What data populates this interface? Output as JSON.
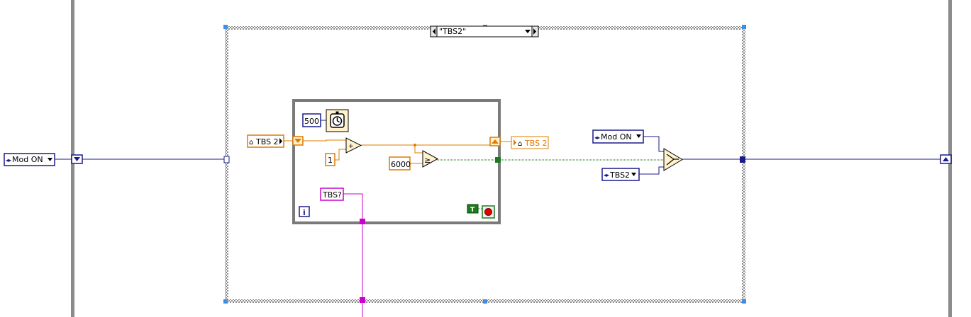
{
  "colors": {
    "enum_blue": "#1a1a8c",
    "numeric_orange": "#e07b00",
    "string_pink": "#cc00cc",
    "boolean_green": "#006600",
    "loop_frame": "#7a7a7a",
    "selection_blue": "#3c8ee6"
  },
  "outer": {
    "left_enum_label": "Mod ON"
  },
  "case_structure": {
    "selector_label": "\"TBS2\""
  },
  "while_loop": {
    "wait_constant": "500",
    "wait_icon": "stopwatch-icon",
    "shift_register_in_label": "TBS 2",
    "increment_constant": "1",
    "add_symbol": "+",
    "threshold_constant": "6000",
    "compare_symbol": "≥",
    "string_constant": "TBS?",
    "iteration_label": "i",
    "stop_terminal_label": "T",
    "stop_icon": "stop-icon"
  },
  "right_side": {
    "local_var_label": "TBS 2",
    "enum_top_label": "Mod ON",
    "enum_bottom_label": "TBS2",
    "select_icon": "select-icon"
  }
}
